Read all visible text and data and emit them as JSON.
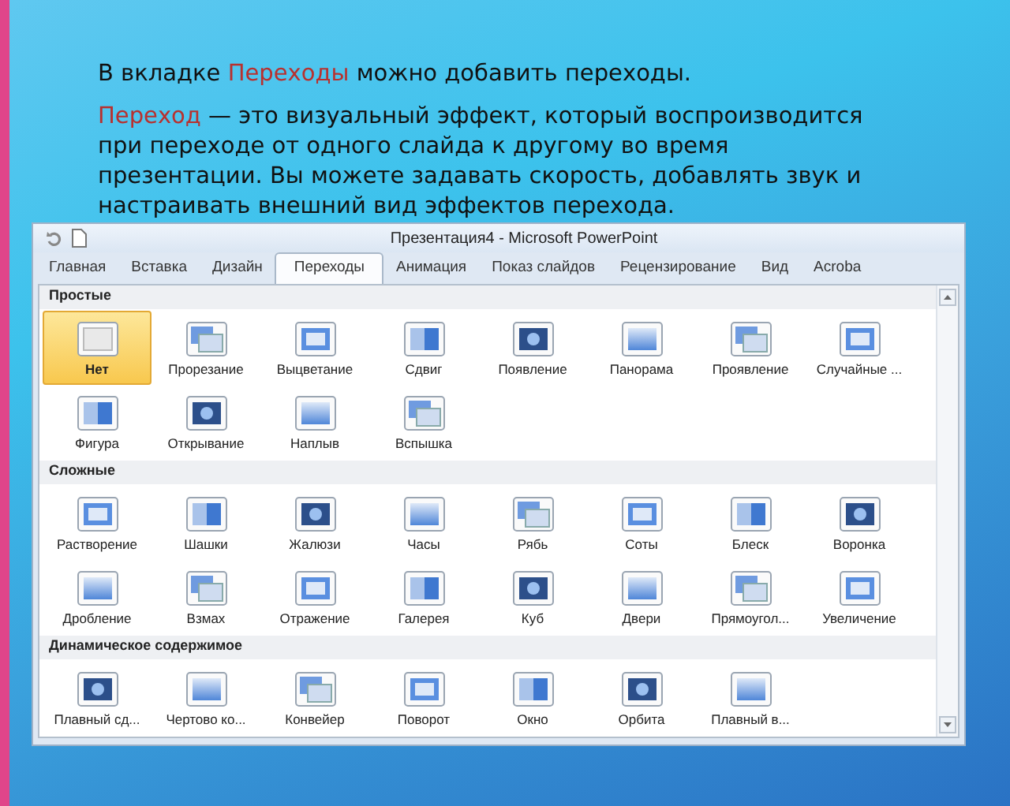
{
  "slide": {
    "line1": {
      "lead": "В вкладке",
      "accent": "Переходы",
      "rest": "можно добавить переходы."
    },
    "line2": {
      "accent": "Переход",
      "rest": "— это визуальный эффект, который воспроизводится при переходе от одного слайда к другому во время презентации. Вы можете задавать скорость, добавлять звук и настраивать внешний вид эффектов перехода."
    }
  },
  "window": {
    "title": "Презентация4  -  Microsoft PowerPoint"
  },
  "tabs": [
    {
      "label": "Главная",
      "selected": false
    },
    {
      "label": "Вставка",
      "selected": false
    },
    {
      "label": "Дизайн",
      "selected": false
    },
    {
      "label": "Переходы",
      "selected": true
    },
    {
      "label": "Анимация",
      "selected": false
    },
    {
      "label": "Показ слайдов",
      "selected": false
    },
    {
      "label": "Рецензирование",
      "selected": false
    },
    {
      "label": "Вид",
      "selected": false
    },
    {
      "label": "Acroba",
      "selected": false
    }
  ],
  "gallery": [
    {
      "title": "Простые",
      "items": [
        {
          "label": "Нет",
          "selected": true
        },
        {
          "label": "Прорезание",
          "selected": false
        },
        {
          "label": "Выцветание",
          "selected": false
        },
        {
          "label": "Сдвиг",
          "selected": false
        },
        {
          "label": "Появление",
          "selected": false
        },
        {
          "label": "Панорама",
          "selected": false
        },
        {
          "label": "Проявление",
          "selected": false
        },
        {
          "label": "Случайные ...",
          "selected": false
        },
        {
          "label": "Фигура",
          "selected": false
        },
        {
          "label": "Открывание",
          "selected": false
        },
        {
          "label": "Наплыв",
          "selected": false
        },
        {
          "label": "Вспышка",
          "selected": false
        }
      ]
    },
    {
      "title": "Сложные",
      "items": [
        {
          "label": "Растворение",
          "selected": false
        },
        {
          "label": "Шашки",
          "selected": false
        },
        {
          "label": "Жалюзи",
          "selected": false
        },
        {
          "label": "Часы",
          "selected": false
        },
        {
          "label": "Рябь",
          "selected": false
        },
        {
          "label": "Соты",
          "selected": false
        },
        {
          "label": "Блеск",
          "selected": false
        },
        {
          "label": "Воронка",
          "selected": false
        },
        {
          "label": "Дробление",
          "selected": false
        },
        {
          "label": "Взмах",
          "selected": false
        },
        {
          "label": "Отражение",
          "selected": false
        },
        {
          "label": "Галерея",
          "selected": false
        },
        {
          "label": "Куб",
          "selected": false
        },
        {
          "label": "Двери",
          "selected": false
        },
        {
          "label": "Прямоугол...",
          "selected": false
        },
        {
          "label": "Увеличение",
          "selected": false
        }
      ]
    },
    {
      "title": "Динамическое содержимое",
      "items": [
        {
          "label": "Плавный сд...",
          "selected": false
        },
        {
          "label": "Чертово ко...",
          "selected": false
        },
        {
          "label": "Конвейер",
          "selected": false
        },
        {
          "label": "Поворот",
          "selected": false
        },
        {
          "label": "Окно",
          "selected": false
        },
        {
          "label": "Орбита",
          "selected": false
        },
        {
          "label": "Плавный в...",
          "selected": false
        }
      ]
    }
  ]
}
